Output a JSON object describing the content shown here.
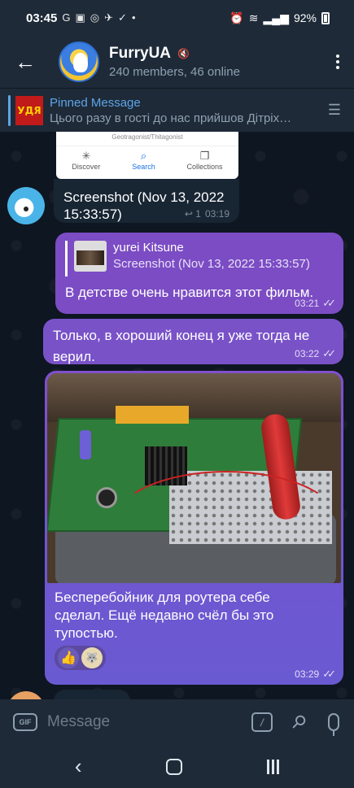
{
  "status_bar": {
    "time": "03:45",
    "left_icons": [
      "G",
      "▣",
      "◎",
      "✈",
      "✓",
      "•"
    ],
    "battery": "92%"
  },
  "header": {
    "title": "FurryUA",
    "subtitle": "240 members, 46 online"
  },
  "pinned": {
    "label": "Pinned Message",
    "text": "Цього разу в гості до нас прийшов Дітріх…",
    "thumb_text": "УДЯ"
  },
  "messages": {
    "card_fragment": {
      "crumb": "Geotragonist/Thitagonist",
      "tabs": [
        {
          "label": "Discover",
          "icon": "✳"
        },
        {
          "label": "Search",
          "icon": "⌕"
        },
        {
          "label": "Collections",
          "icon": "❐"
        }
      ]
    },
    "incoming_screenshot": {
      "text": "Screenshot (Nov 13, 2022 15:33:57)",
      "replies": "↩ 1",
      "time": "03:19"
    },
    "reply_message": {
      "quote_name": "yurei Kitsune",
      "quote_text": "Screenshot (Nov 13, 2022 15:33:57)",
      "text": "В детстве очень нравится этот фильм.",
      "time": "03:21"
    },
    "text_message": {
      "text": "Только, в хороший конец я уже тогда не верил.",
      "time": "03:22"
    },
    "photo_message": {
      "caption": "Бесперебойник для роутера себе сделал. Ещё недавно  счёл бы это тупостью.",
      "reactions": [
        "👍",
        "🐺"
      ],
      "time": "03:29"
    }
  },
  "input": {
    "placeholder": "Message",
    "gif_label": "GIF",
    "cmd_label": "/"
  },
  "colors": {
    "outgoing_bubble": "#7b4cc4",
    "incoming_bubble": "#182533",
    "accent": "#5ea5e8",
    "background": "#0e1621"
  }
}
